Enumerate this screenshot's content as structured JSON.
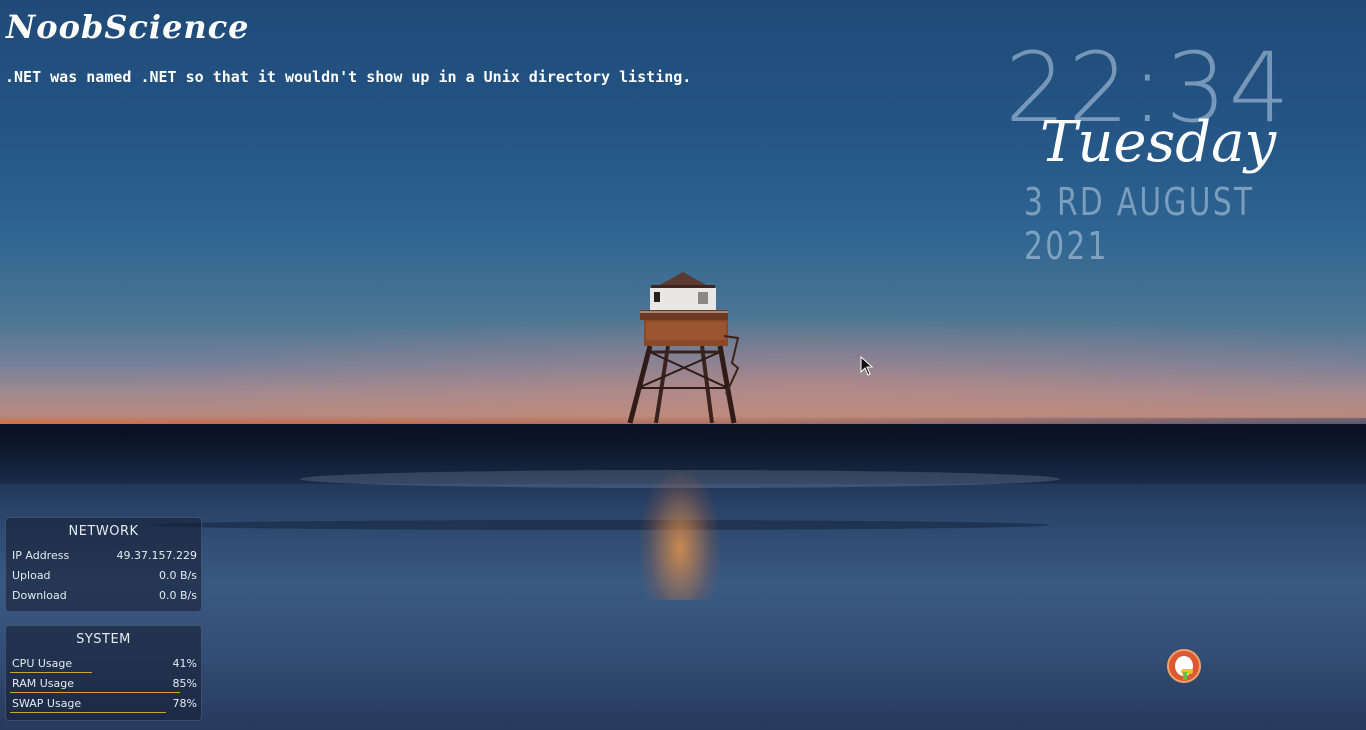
{
  "branding": {
    "title": "NoobScience"
  },
  "quote": ".NET was named .NET so that it wouldn't show up in a Unix directory listing.",
  "clock": {
    "time": "22:34",
    "day": "Tuesday",
    "date": "3 RD AUGUST 2021"
  },
  "network": {
    "title": "NETWORK",
    "rows": [
      {
        "label": "IP Address",
        "value": "49.37.157.229"
      },
      {
        "label": "Upload",
        "value": "0.0 B/s"
      },
      {
        "label": "Download",
        "value": "0.0 B/s"
      }
    ]
  },
  "system": {
    "title": "SYSTEM",
    "rows": [
      {
        "label": "CPU Usage",
        "value": "41%",
        "level": 0.41
      },
      {
        "label": "RAM Usage",
        "value": "85%",
        "level": 0.85
      },
      {
        "label": "SWAP Usage",
        "value": "78%",
        "level": 0.78
      }
    ]
  },
  "colors": {
    "accent_bar": "#d9a12a",
    "ddg_orange": "#de5833"
  },
  "icons": {
    "search_launcher": "duckduckgo-icon",
    "pointer": "mouse-cursor-icon"
  }
}
